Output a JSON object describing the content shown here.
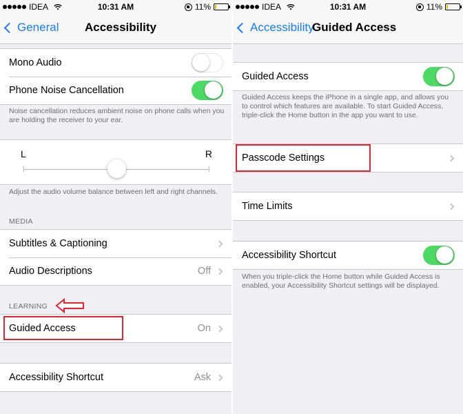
{
  "status_bar": {
    "carrier": "IDEA",
    "time": "10:31 AM",
    "battery": "11%",
    "battery_level": 0.11
  },
  "left": {
    "nav": {
      "back": "General",
      "title": "Accessibility"
    },
    "mono_audio": {
      "label": "Mono Audio",
      "on": false
    },
    "noise_cancel": {
      "label": "Phone Noise Cancellation",
      "on": true
    },
    "noise_footnote": "Noise cancellation reduces ambient noise on phone calls when you are holding the receiver to your ear.",
    "balance": {
      "left_label": "L",
      "right_label": "R",
      "value": 0.5
    },
    "balance_footnote": "Adjust the audio volume balance between left and right channels.",
    "media_header": "MEDIA",
    "subtitles": {
      "label": "Subtitles & Captioning"
    },
    "audio_desc": {
      "label": "Audio Descriptions",
      "value": "Off"
    },
    "learning_header": "LEARNING",
    "guided_access": {
      "label": "Guided Access",
      "value": "On"
    },
    "shortcut": {
      "label": "Accessibility Shortcut",
      "value": "Ask"
    }
  },
  "right": {
    "nav": {
      "back": "Accessibility",
      "title": "Guided Access"
    },
    "guided_access": {
      "label": "Guided Access",
      "on": true
    },
    "guided_footnote": "Guided Access keeps the iPhone in a single app, and allows you to control which features are available. To start Guided Access, triple-click the Home button in the app you want to use.",
    "passcode": {
      "label": "Passcode Settings"
    },
    "time_limits": {
      "label": "Time Limits"
    },
    "shortcut": {
      "label": "Accessibility Shortcut",
      "on": true
    },
    "shortcut_footnote": "When you triple-click the Home button while Guided Access is enabled, your Accessibility Shortcut settings will be displayed."
  },
  "colors": {
    "accent": "#147efb",
    "toggle_on": "#4cd964",
    "highlight": "#e8212d",
    "background": "#efeff4"
  }
}
